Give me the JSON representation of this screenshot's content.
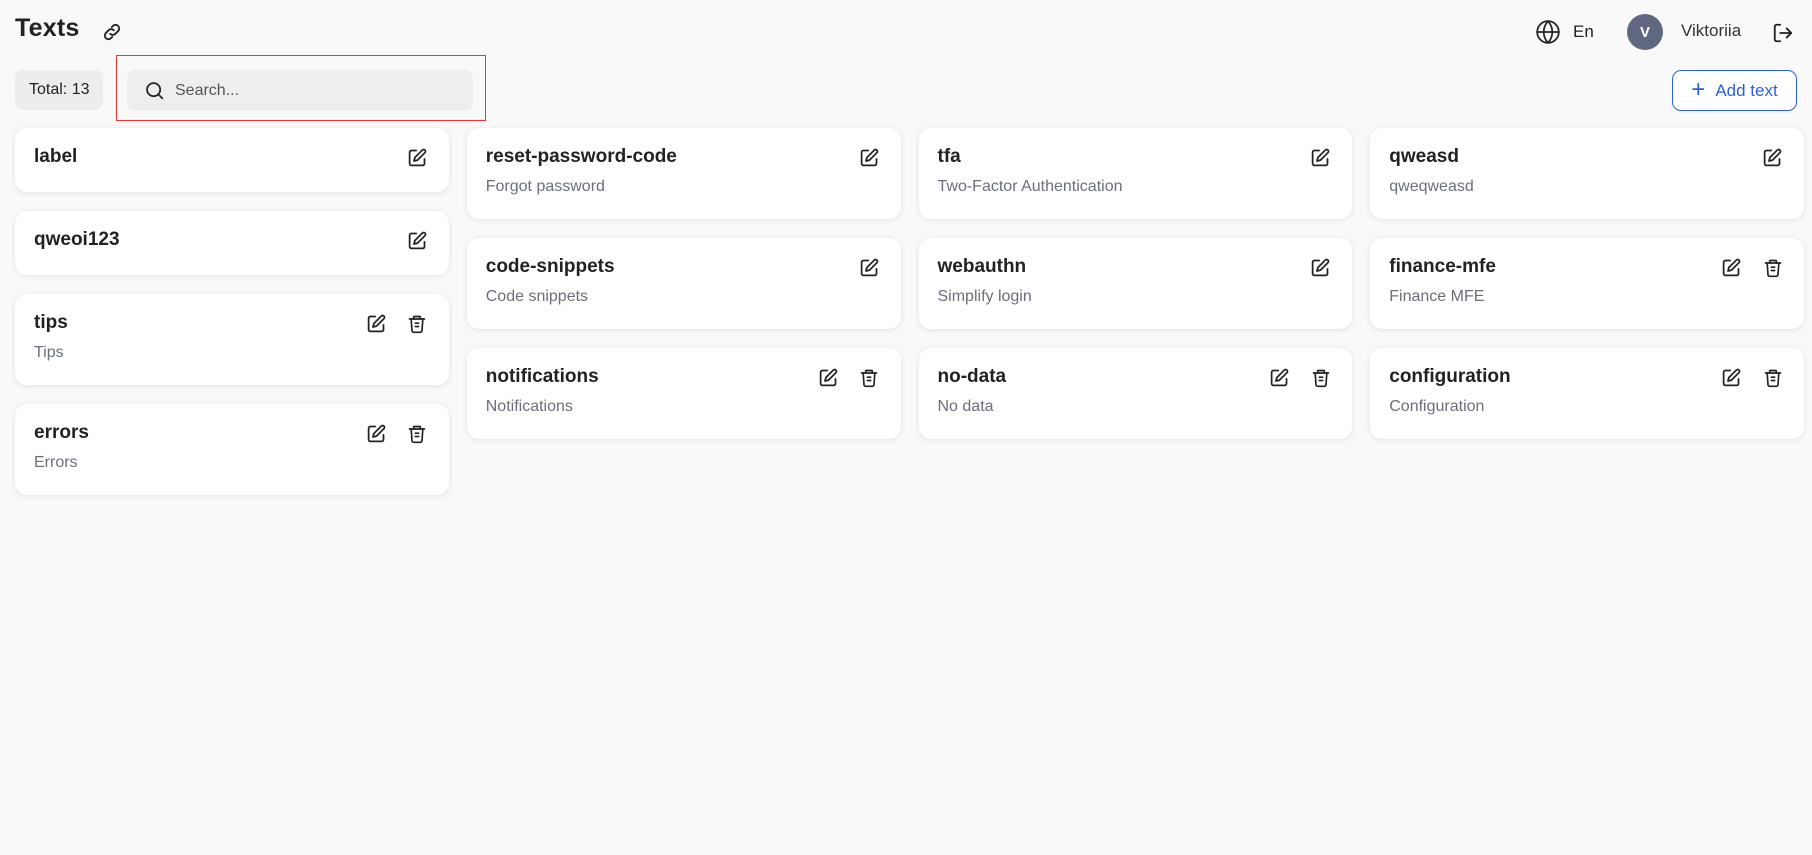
{
  "header": {
    "title": "Texts",
    "language": "En",
    "avatar_initial": "V",
    "username": "Viktoriia"
  },
  "toolbar": {
    "total_label": "Total: 13",
    "search_placeholder": "Search...",
    "search_value": "",
    "add_label": "Add text"
  },
  "columns": [
    [
      {
        "title": "label",
        "subtitle": "",
        "deletable": false
      },
      {
        "title": "qweoi123",
        "subtitle": "",
        "deletable": false
      },
      {
        "title": "tips",
        "subtitle": "Tips",
        "deletable": true
      },
      {
        "title": "errors",
        "subtitle": "Errors",
        "deletable": true
      }
    ],
    [
      {
        "title": "reset-password-code",
        "subtitle": "Forgot password",
        "deletable": false
      },
      {
        "title": "code-snippets",
        "subtitle": "Code snippets",
        "deletable": false
      },
      {
        "title": "notifications",
        "subtitle": "Notifications",
        "deletable": true
      }
    ],
    [
      {
        "title": "tfa",
        "subtitle": "Two-Factor Authentication",
        "deletable": false
      },
      {
        "title": "webauthn",
        "subtitle": "Simplify login",
        "deletable": false
      },
      {
        "title": "no-data",
        "subtitle": "No data",
        "deletable": true
      }
    ],
    [
      {
        "title": "qweasd",
        "subtitle": "qweqweasd",
        "deletable": false
      },
      {
        "title": "finance-mfe",
        "subtitle": "Finance MFE",
        "deletable": true
      },
      {
        "title": "configuration",
        "subtitle": "Configuration",
        "deletable": true
      }
    ]
  ],
  "colors": {
    "accent": "#2b5fd9",
    "avatar_bg": "#5f6880",
    "highlight_border": "#e53935",
    "page_bg": "#f9f9f9"
  },
  "icons": {
    "header_link": "link-icon",
    "language": "globe-icon",
    "logout": "logout-icon",
    "search": "search-icon",
    "edit": "edit-icon",
    "delete": "trash-icon",
    "add": "plus-icon"
  }
}
